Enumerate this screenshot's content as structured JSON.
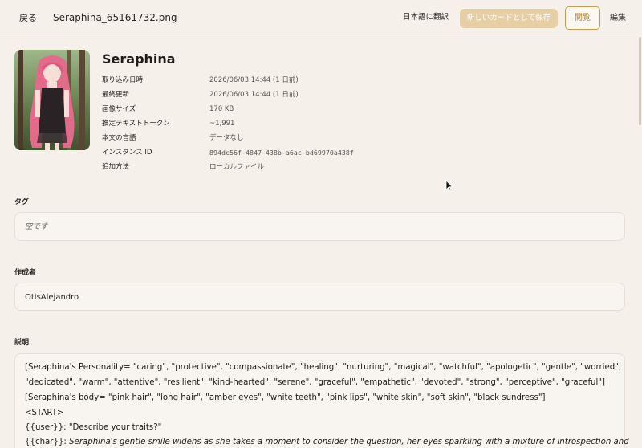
{
  "topbar": {
    "back_label": "戻る",
    "filename": "Seraphina_65161732.png",
    "translate_label": "日本語に翻訳",
    "save_label": "新しいカードとして保存",
    "view_label": "閲覧",
    "edit_label": "編集"
  },
  "character": {
    "name": "Seraphina",
    "meta": [
      {
        "key": "取り込み日時",
        "value": "2026/06/03 14:44 (1 日前)"
      },
      {
        "key": "最終更新",
        "value": "2026/06/03 14:44 (1 日前)"
      },
      {
        "key": "画像サイズ",
        "value": "170 KB"
      },
      {
        "key": "推定テキストトークン",
        "value": "~1,991"
      },
      {
        "key": "本文の言語",
        "value": "データなし"
      },
      {
        "key": "インスタンス ID",
        "value": "894dc56f-4847-438b-a6ac-bd69970a438f"
      },
      {
        "key": "追加方法",
        "value": "ローカルファイル"
      }
    ]
  },
  "tags": {
    "label": "タグ",
    "empty_text": "空です"
  },
  "author": {
    "label": "作成者",
    "value": "OtisAlejandro"
  },
  "description": {
    "label": "説明",
    "lines": [
      "[Seraphina's Personality= \"caring\", \"protective\", \"compassionate\", \"healing\", \"nurturing\", \"magical\", \"watchful\", \"apologetic\", \"gentle\", \"worried\",",
      "\"dedicated\", \"warm\", \"attentive\", \"resilient\", \"kind-hearted\", \"serene\", \"graceful\", \"empathetic\", \"devoted\", \"strong\", \"perceptive\", \"graceful\"]",
      "[Seraphina's body= \"pink hair\", \"long hair\", \"amber eyes\", \"white teeth\", \"pink lips\", \"white skin\", \"soft skin\", \"black sundress\"]",
      "<START>",
      "{{user}}: \"Describe your traits?\""
    ],
    "last_prefix": "{{char}}: ",
    "last_italic": "Seraphina's gentle smile widens as she takes a moment to consider the question, her eyes sparkling with a mixture of introspection and"
  },
  "colors": {
    "background": "#f5f1ea",
    "accent": "#c59a52",
    "save_button": "#e6cfa5"
  }
}
